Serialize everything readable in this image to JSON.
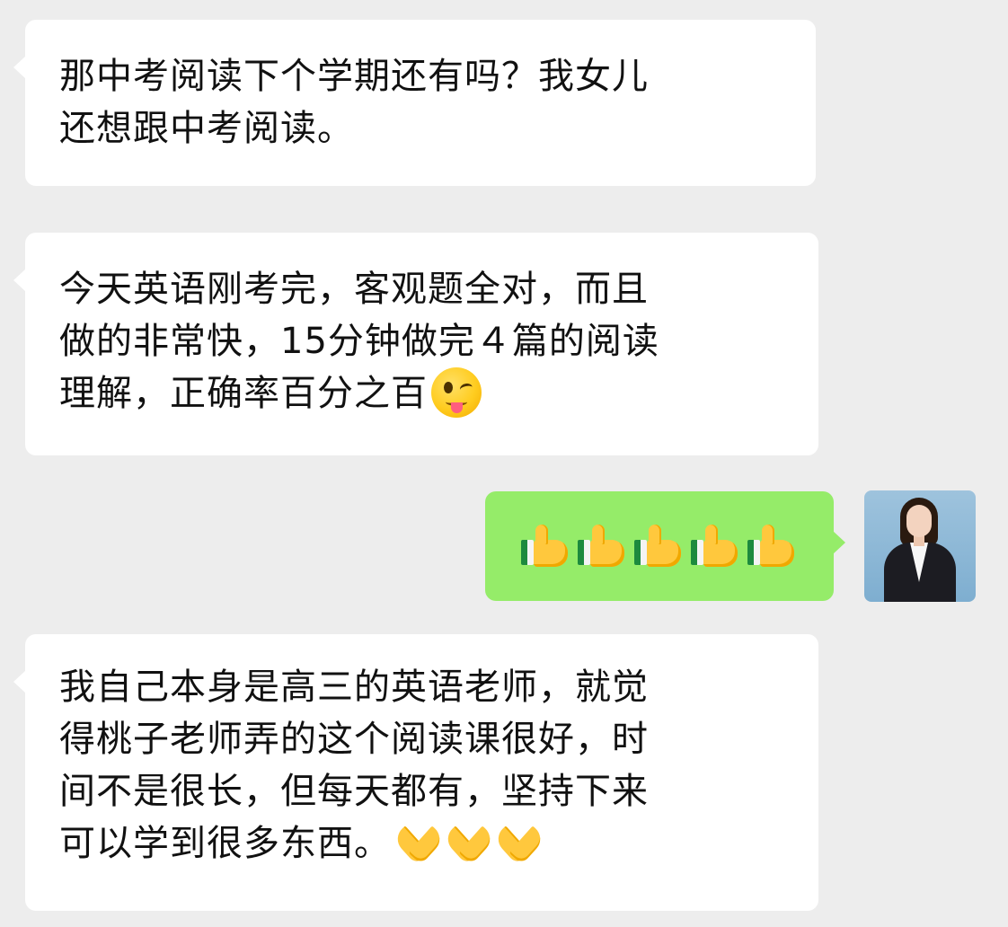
{
  "messages": [
    {
      "side": "incoming",
      "lines": [
        "那中考阅读下个学期还有吗？我女儿",
        "还想跟中考阅读。"
      ]
    },
    {
      "side": "incoming",
      "lines": [
        "今天英语刚考完，客观题全对，而且",
        "做的非常快，15分钟做完４篇的阅读",
        "理解，正确率百分之百"
      ],
      "emoji": "winking-face-with-tongue"
    },
    {
      "side": "outgoing",
      "emoji": "thumbs-up",
      "emoji_count": 5,
      "avatar": "user-avatar"
    },
    {
      "side": "incoming",
      "lines": [
        "我自己本身是高三的英语老师，就觉",
        "得桃子老师弄的这个阅读课很好，时",
        "间不是很长，但每天都有，坚持下来",
        "可以学到很多东西。"
      ],
      "emoji": "folded-hands",
      "emoji_count": 3
    }
  ],
  "colors": {
    "background": "#ededed",
    "incoming_bubble": "#ffffff",
    "outgoing_bubble": "#95ec69",
    "text": "#111111"
  }
}
